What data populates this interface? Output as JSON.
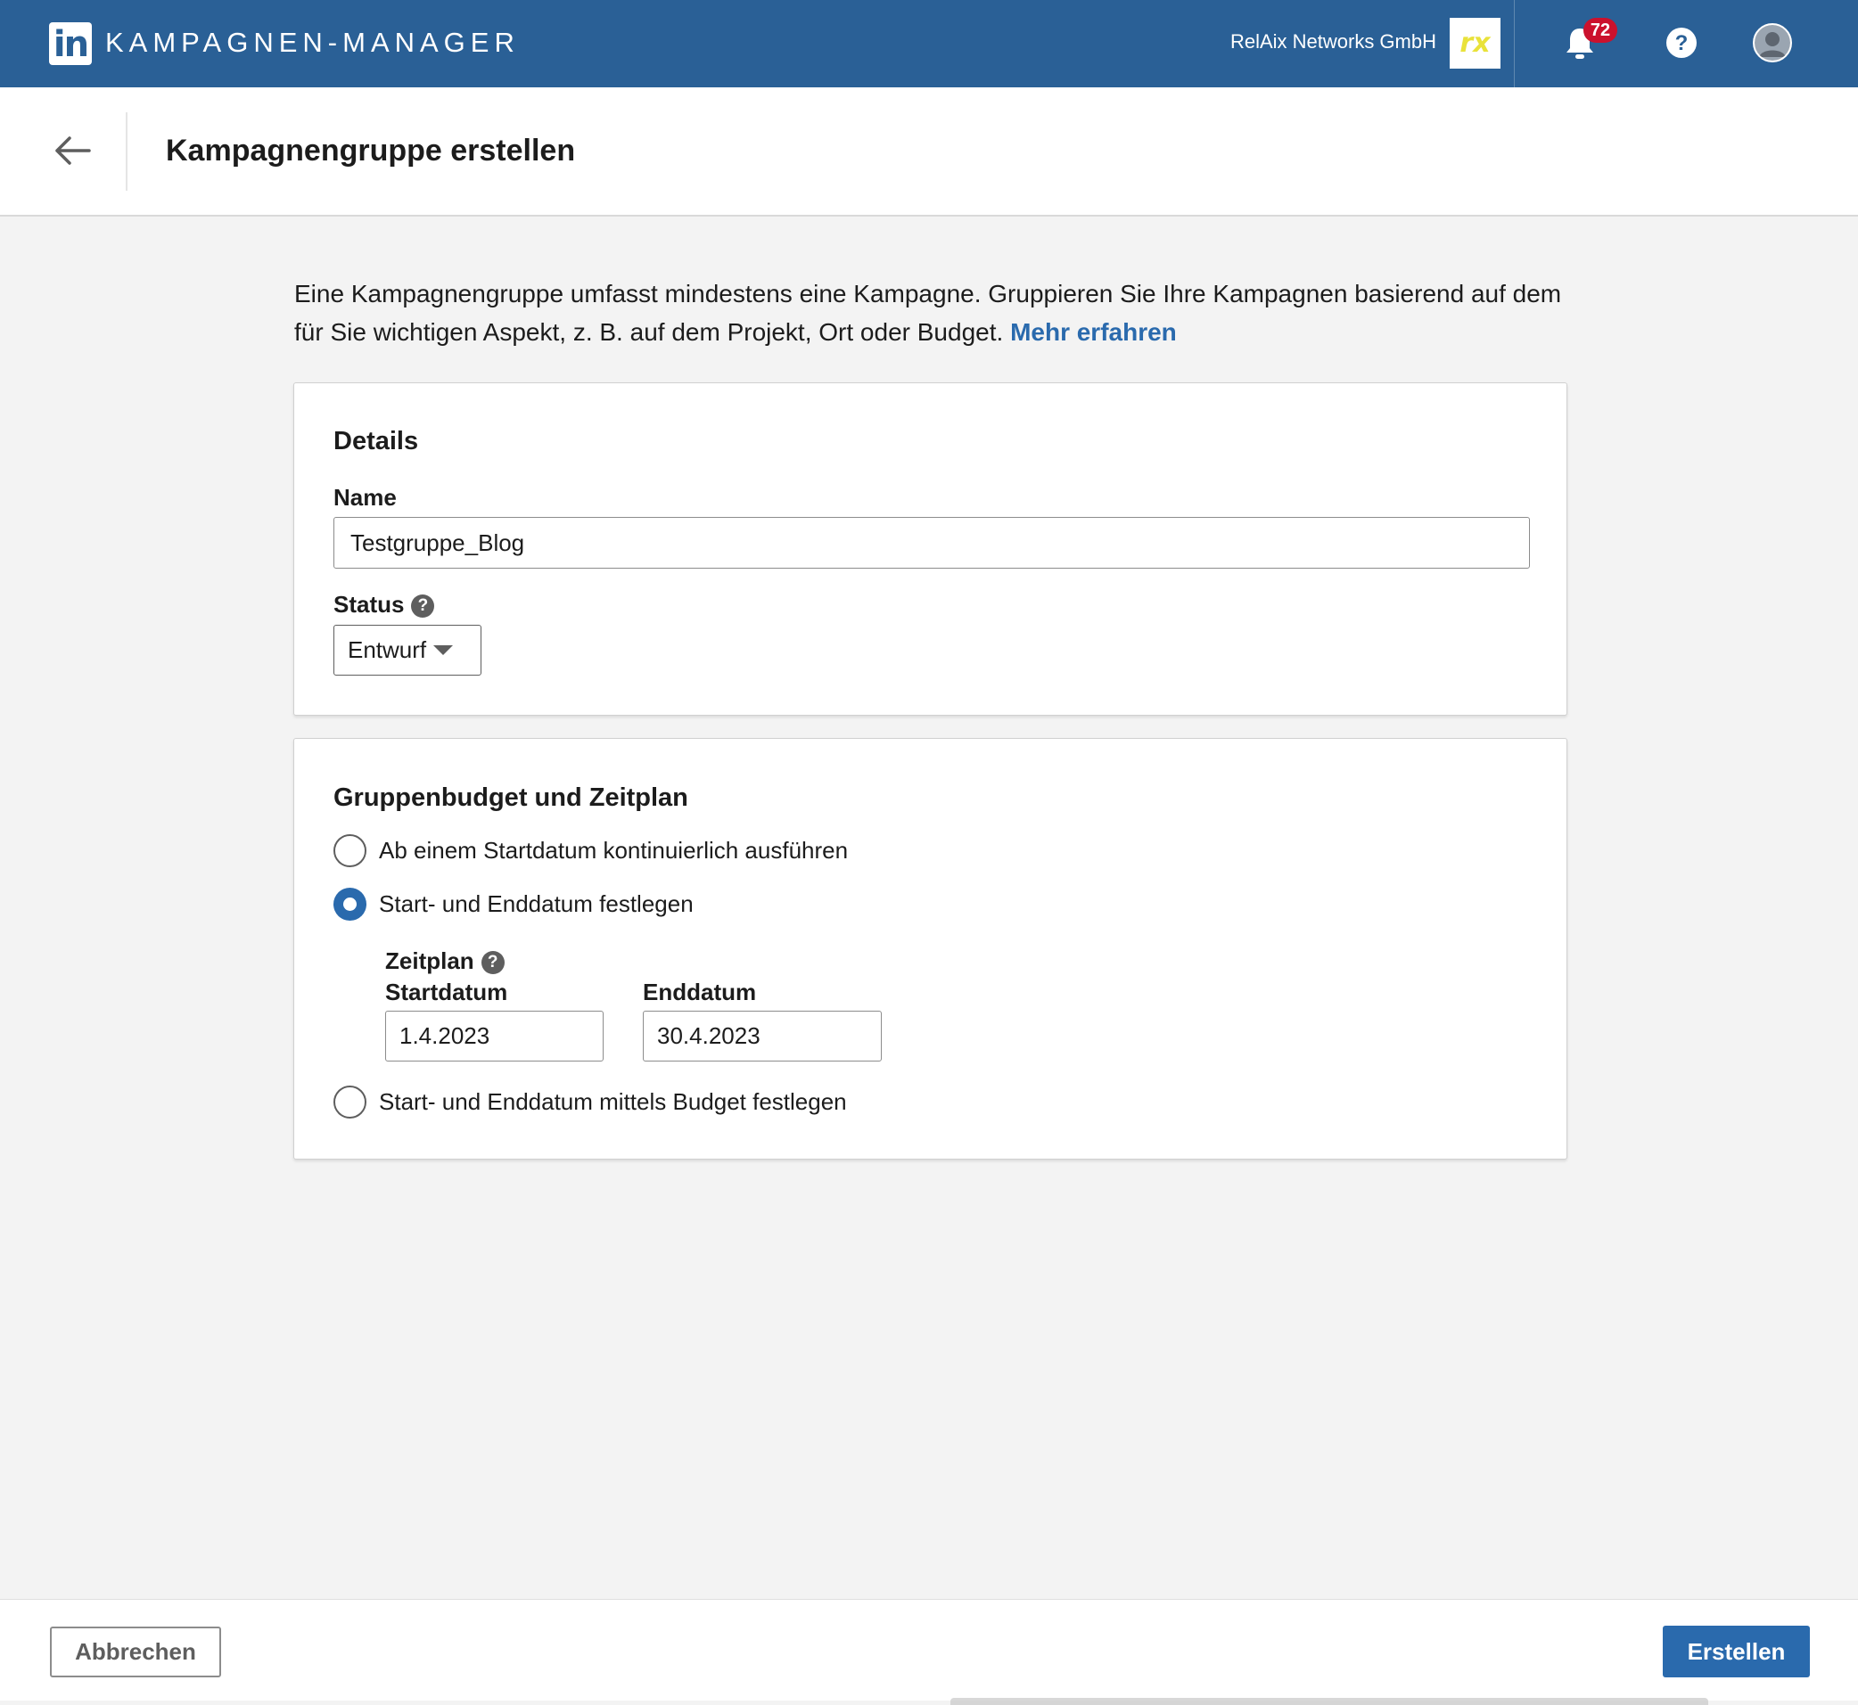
{
  "topbar": {
    "logo_text": "in",
    "app_title": "KAMPAGNEN-MANAGER",
    "account_name": "RelAix Networks GmbH",
    "account_logo_text": "rx",
    "notification_count": "72",
    "brand_color": "#2a6096",
    "badge_color": "#cb112d"
  },
  "header": {
    "title": "Kampagnengruppe erstellen"
  },
  "intro": {
    "text": "Eine Kampagnengruppe umfasst mindestens eine Kampagne. Gruppieren Sie Ihre Kampagnen basierend auf dem für Sie wichtigen Aspekt, z. B. auf dem Projekt, Ort oder Budget. ",
    "link": "Mehr erfahren"
  },
  "details": {
    "heading": "Details",
    "name_label": "Name",
    "name_value": "Testgruppe_Blog",
    "status_label": "Status",
    "status_value": "Entwurf"
  },
  "budget": {
    "heading": "Gruppenbudget und Zeitplan",
    "options": [
      {
        "label": "Ab einem Startdatum kontinuierlich ausführen",
        "checked": false
      },
      {
        "label": "Start- und Enddatum festlegen",
        "checked": true
      },
      {
        "label": "Start- und Enddatum mittels Budget festlegen",
        "checked": false
      }
    ],
    "schedule_label": "Zeitplan",
    "start_label": "Startdatum",
    "start_value": "1.4.2023",
    "end_label": "Enddatum",
    "end_value": "30.4.2023"
  },
  "footer": {
    "cancel_label": "Abbrechen",
    "create_label": "Erstellen",
    "accent_color": "#2a6aad"
  }
}
